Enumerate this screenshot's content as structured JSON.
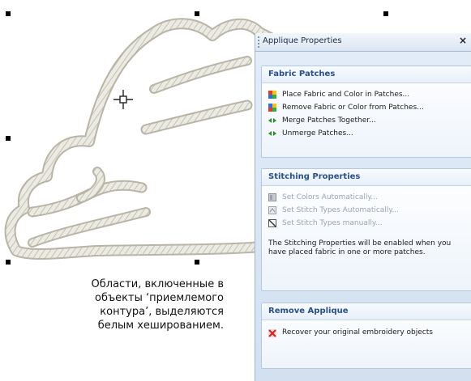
{
  "caption": "Области, включенные в\nобъекты ‘приемлемого\nконтура’, выделяются\nбелым хешированием.",
  "panel": {
    "title": "Applique Properties",
    "close_glyph": "×",
    "sections": {
      "fabric": {
        "header": "Fabric Patches",
        "items": [
          {
            "label": "Place Fabric and Color in Patches...",
            "icon": "color-patch-icon"
          },
          {
            "label": "Remove Fabric or Color from Patches...",
            "icon": "color-patch-icon"
          },
          {
            "label": "Merge Patches Together...",
            "icon": "merge-arrows-icon"
          },
          {
            "label": "Unmerge Patches...",
            "icon": "merge-arrows-icon"
          }
        ]
      },
      "stitching": {
        "header": "Stitching Properties",
        "items": [
          {
            "label": "Set Colors Automatically...",
            "icon": "set-colors-icon"
          },
          {
            "label": "Set Stitch Types Automatically...",
            "icon": "stitch-types-auto-icon"
          },
          {
            "label": "Set Stitch Types manually...",
            "icon": "stitch-types-manual-icon"
          }
        ],
        "note": "The Stitching Properties will be enabled when you have placed fabric in one or more patches."
      },
      "remove": {
        "header": "Remove Applique",
        "items": [
          {
            "label": "Recover your original embroidery objects",
            "icon": "red-x-icon"
          }
        ]
      }
    }
  },
  "colors": {
    "panel_bg": "#d2e0f0",
    "header_text": "#2a4f8a",
    "disabled_text": "#9aa4b0",
    "stitch_light": "#f1f0ea",
    "stitch_dark": "#b7b4a6"
  }
}
